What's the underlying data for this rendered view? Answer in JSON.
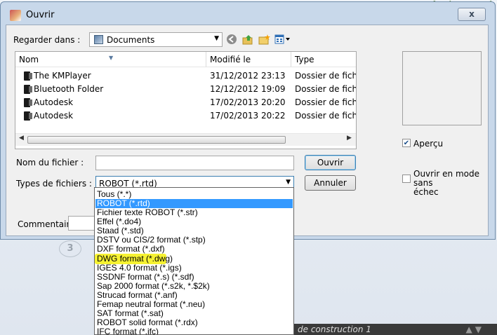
{
  "dialog": {
    "title": "Ouvrir",
    "close_symbol": "x",
    "look_in_label": "Regarder dans :",
    "look_in_value": "Documents"
  },
  "toolbar_icons": [
    "back-icon",
    "up-folder-icon",
    "new-folder-icon",
    "view-menu-icon"
  ],
  "file_list": {
    "columns": [
      "Nom",
      "Modifié le",
      "Type"
    ],
    "rows": [
      {
        "name": "The KMPlayer",
        "modified": "31/12/2012 23:13",
        "type": "Dossier de fichier"
      },
      {
        "name": "Bluetooth Folder",
        "modified": "12/12/2012 19:09",
        "type": "Dossier de fichier"
      },
      {
        "name": "Autodesk",
        "modified": "17/02/2013 20:20",
        "type": "Dossier de fichier"
      },
      {
        "name": "Autodesk",
        "modified": "17/02/2013 20:22",
        "type": "Dossier de fichier"
      }
    ]
  },
  "form": {
    "filename_label": "Nom du fichier :",
    "filename_value": "",
    "filetype_label": "Types de fichiers :",
    "filetype_value": "ROBOT (*.rtd)",
    "comment_label": "Commentaire :",
    "open_button": "Ouvrir",
    "cancel_button": "Annuler"
  },
  "side": {
    "preview_label": "Aperçu",
    "preview_checked": true,
    "fail_safe_label_1": "Ouvrir en mode sans",
    "fail_safe_label_2": "échec",
    "fail_safe_checked": false
  },
  "dropdown_options": [
    "Tous (*.*)",
    "ROBOT (*.rtd)",
    "Fichier texte ROBOT (*.str)",
    "Effel (*.do4)",
    "Staad (*.std)",
    "DSTV ou CIS/2 format (*.stp)",
    "DXF format (*.dxf)",
    "DWG format (*.dwg)",
    "IGES 4.0 format (*.igs)",
    "SSDNF format (*.s) (*.sdf)",
    "Sap 2000 format (*.s2k, *.$2k)",
    "Strucad format (*.anf)",
    "Femap neutral format (*.neu)",
    "SAT format (*.sat)",
    "ROBOT solid format (*.rdx)",
    "IFC format (*.ifc)"
  ],
  "selected_option_index": 1,
  "highlighted_option_index": 7,
  "background": {
    "strip_text": "de construction 1",
    "circle_label": "3"
  }
}
